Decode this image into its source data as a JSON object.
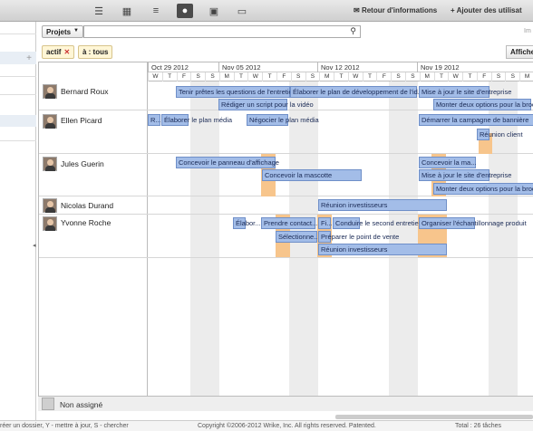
{
  "topbar": {
    "icons": [
      "menu-icon",
      "grid-icon",
      "list-icon",
      "person-icon",
      "calendar-icon",
      "chat-icon"
    ],
    "feedback": "Retour d'informations",
    "add_user": "Ajouter des utilisat"
  },
  "filter": {
    "dropdown": "Projets",
    "search_placeholder": "",
    "im_label": "Im",
    "tag_active": "actif",
    "tag_all": "à : tous",
    "affiche": "Affiche"
  },
  "timeline": {
    "weeks": [
      "Oct 29 2012",
      "Nov 05 2012",
      "Nov 12 2012",
      "Nov 19 2012"
    ],
    "days": [
      "W",
      "T",
      "F",
      "S",
      "S",
      "M",
      "T",
      "W",
      "T",
      "F",
      "S",
      "S",
      "M",
      "T",
      "W",
      "T",
      "F",
      "S",
      "S",
      "M",
      "T",
      "W",
      "T",
      "F",
      "S",
      "S",
      "M"
    ]
  },
  "people": [
    {
      "name": "Bernard Roux"
    },
    {
      "name": "Ellen Picard"
    },
    {
      "name": "Jules Guerin"
    },
    {
      "name": "Nicolas Durand"
    },
    {
      "name": "Yvonne Roche"
    }
  ],
  "tasks": {
    "t1": "Tenir prêtes les questions de l'entretien",
    "t2": "Élaborer le plan de développement de l'id...",
    "t3": "Mise à jour le site d'entreprise",
    "t4": "Rédiger un script pour la vidéo",
    "t5": "Monter deux options pour la broch",
    "t6": "R...",
    "t7": "Élaborer le plan média",
    "t8": "Négocier le plan média",
    "t9": "Démarrer la campagne de bannière",
    "t10": "Réunion client",
    "t11": "Concevoir le panneau d'affichage",
    "t12": "Concevoir la ma...",
    "t13": "Mise à jour le site d'entreprise",
    "t14": "Concevoir la mascotte",
    "t15": "Monter deux options pour la broch",
    "t16": "Réunion investisseurs",
    "t17": "Élabor...",
    "t18": "Prendre contact...",
    "t19": "Fi...",
    "t20": "Conduire le second entretien",
    "t21": "Organiser l'échantillonnage produit",
    "t22": "Sélectionne...",
    "t23": "Préparer le point de vente",
    "t24": "Réunion investisseurs"
  },
  "unassigned": "Non assigné",
  "footer": {
    "shortcuts": "réer un dossier, Y - mettre à jour, S - chercher",
    "copyright": "Copyright ©2006-2012 Wrike, Inc. All rights reserved. Patented.",
    "total": "Total : 26 tâches"
  }
}
